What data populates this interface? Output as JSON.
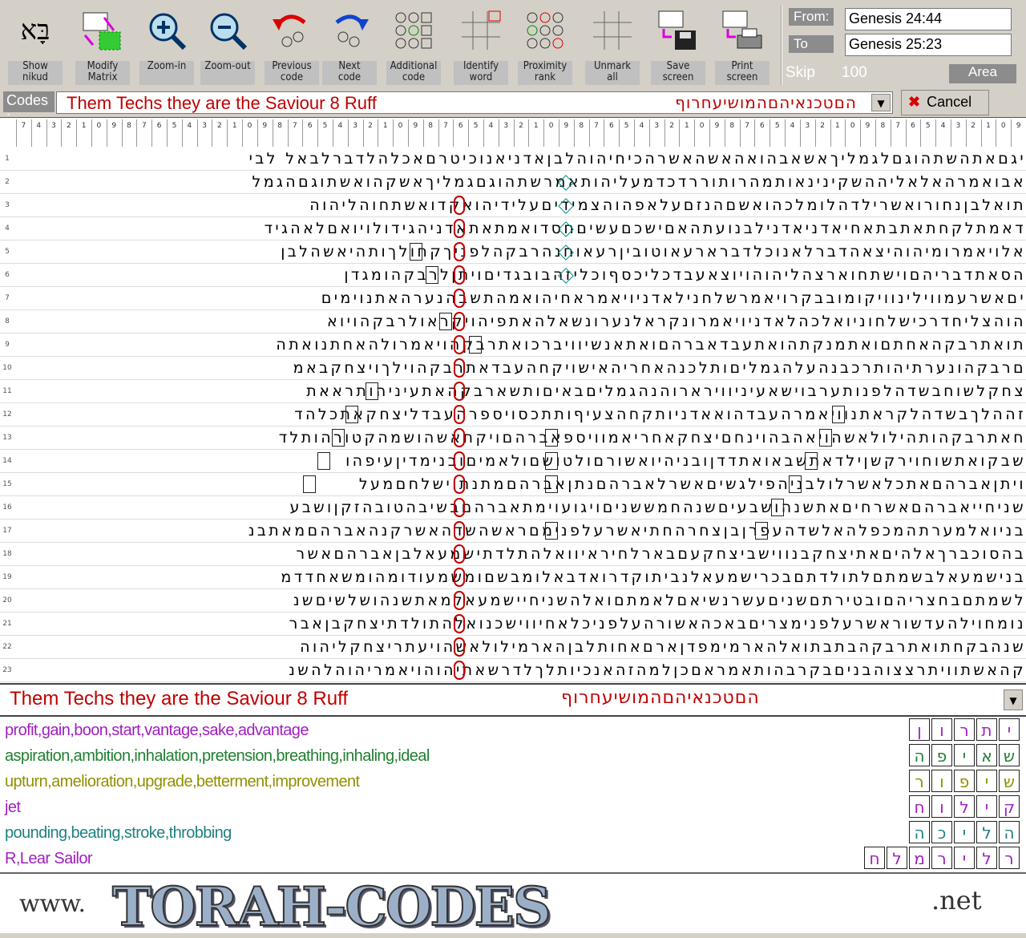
{
  "toolbar": {
    "buttons": [
      {
        "icon": "hebrew-nikud-icon",
        "label": "Show\nnikud"
      },
      {
        "icon": "matrix-edit-icon",
        "label": "Modify\nMatrix"
      },
      {
        "icon": "zoom-in-icon",
        "label": "Zoom-in"
      },
      {
        "icon": "zoom-out-icon",
        "label": "Zoom-out"
      },
      {
        "icon": "previous-code-icon",
        "label": "Previous\ncode"
      },
      {
        "icon": "next-code-icon",
        "label": "Next\ncode"
      },
      {
        "icon": "additional-code-icon",
        "label": "Additional\ncode"
      },
      {
        "icon": "identify-word-icon",
        "label": "Identify\nword"
      },
      {
        "icon": "proximity-rank-icon",
        "label": "Proximity\nrank"
      },
      {
        "icon": "unmark-all-icon",
        "label": "Unmark\nall"
      },
      {
        "icon": "save-screen-icon",
        "label": "Save\nscreen"
      },
      {
        "icon": "print-screen-icon",
        "label": "Print\nscreen"
      }
    ],
    "nikud_glyph": "בָּא",
    "from_label": "From:",
    "from_value": "Genesis 24:44",
    "to_label": "To",
    "to_value": "Genesis 25:23",
    "skip_label": "Skip",
    "skip_value": "100",
    "area_label": "Area"
  },
  "codes": {
    "label": "Codes :",
    "english": "Them Techs they are the Saviour 8 Ruff",
    "hebrew": "הםטכנאיהםהמושיעחרוף",
    "cancel_label": "Cancel"
  },
  "ruler": [
    "7",
    "4",
    "3",
    "2",
    "1",
    "0",
    "9",
    "8",
    "7",
    "6",
    "5",
    "4",
    "3",
    "2",
    "1",
    "0",
    "9",
    "8",
    "7",
    "6",
    "5",
    "4",
    "3",
    "2",
    "1",
    "0",
    "9",
    "8",
    "7",
    "6",
    "5",
    "4",
    "3",
    "2",
    "1",
    "0",
    "9",
    "8",
    "7",
    "6",
    "5",
    "4",
    "3",
    "2",
    "1",
    "0",
    "9",
    "8",
    "7",
    "6",
    "5",
    "4",
    "3",
    "2",
    "1",
    "0",
    "9",
    "8",
    "7",
    "6",
    "5",
    "4",
    "3",
    "2",
    "1",
    "0",
    "9"
  ],
  "grid": {
    "row_numbers": [
      "1",
      "2",
      "3",
      "4",
      "5",
      "6",
      "7",
      "8",
      "9",
      "10",
      "11",
      "12",
      "13",
      "14",
      "15",
      "16",
      "17",
      "18",
      "19",
      "20",
      "21",
      "22",
      "23"
    ],
    "rows": [
      "יגםאתהשתהוגםלגמליךאשאבהואהאשהאשרהכיחיהוהלבןאדניאנוכיטרםאכלהלדברלבאל לבי",
      "אבואמרהאלאליההשקינינאותמהרותוררדכדמעליהותאמרשתהוגםגמליךאשקהואשתוגםהגמל",
      "תואלבןנחורואשרילדהלומלכהואשםהנזםעלאפהוהצמידיםעלידיהואקדואשתחוהליהוה",
      "דאמתלקחתאתבתאחיאדניאדנילבנועתהאםישכםעשיםחסדואמתאתאדניהגידולויואםלאהגיד",
      "אלויאמרומיהוהיצאהדברלאנוכלדברארעאוטוביןרעאוחנהרבקהלפניךקחולךותהיאשהלבן",
      "הסאתדבריהםוישתחוארצהליהוהויוצאעבדכליכסףוכליזהבובגדיםויתןלרבקהומגדן",
      "יםאשרעמווילינוויקומובבקרויאמרשלחנילאדניויאמראחיהואמהתשבהנערהאתנוימים",
      "הוהצליחדרכישלחוניואלכהלאדניויאמרונקראלנערונשאלהאתפיהויקראולרבקהויוא",
      "תואתרבקהאחתםואתמנקתהואתעבדאברהםואתאנשיוויברכואתרבקהויאמרולהאחתנואתה",
      "םרבקהונערתיהותרכבנהעלהגמליםותלכנהאחריהאישויקחהעבדאתרבקהוילךויצחקבאמ",
      "צחקלשוחבשדהלפנותערבוישאעיניווירארוהנהגמליםבאיםותשארבקהאתעיניהותראאת",
      "זההלךבשדהלקראתנוויאמרהעבדהואאדניותקחהצעיףותתכסויספרהעבדליצחקאתכלהד",
      "חאתרבקהותהילולאשהויאהבהוינחםיצחקאחריאמוויספאברהםויקחאשהושמהקטורהותלד",
      "שבקואתשוחוירקשןילדאתשבאואתדדןובניהיואשורםולטושםולאמיםובנימדיןעיפהו",
      "ויתןאברהםאתכלאשרלולבניהפילגשיםאשרלאברהםנתןאברהםמתנתוישלחםמעל",
      "שניחייאברהםאשרחיםאתשנהושבעיםשנהחמששניםויגועוימתאברהםבשיבהטובהזקןושבע",
      "בניואלמערתהמכפלהאלשדהעפרןבןצחרהחתיאשרעלפנימםראשהשדהאשרקנהאברהםמאתבנ",
      "בהסוכברךאלהיםאתיצחקבנווישביצחקעםבארלחיראיוואלהתלדתישמעאלבןאברהםאשר",
      "בנישמעאלבשמתםלתולדתםבכרישמעאלנביתוקדרואדבאלומבשםומשמעודומהומשאחדדמ",
      "לשמתםבחצריהםובטירתםשניםעשרנשיאםלאמתםואלהשניחיישמעאלמאתשנהושלשיםשנ",
      "נומחוילהעדשוראשרעלפנימצריםבאכהאשורהעלפניכלאחיווישכנואלהתולדתיצחקבןאבר",
      "שנהבקחתואתרבקהבתבתואלהארמימפדןארםאחותלבןהארמילולאשהויעתריצחקליהוה",
      "קהאשתוויתרצצוהבניםבקרבהותאמראםכןלמהזהאנכיותלךלדרשאתיהוהויאמריהוהלהשנ"
    ]
  },
  "result": {
    "english": "Them Techs they are the Saviour 8 Ruff",
    "hebrew": "הםטכנאיהםהמושיעחרוף"
  },
  "definitions": [
    {
      "text": "profit,gain,boon,start,vantage,sake,advantage",
      "color": "#a020c0",
      "letters": [
        "י",
        "ת",
        "ר",
        "ו",
        "ן"
      ]
    },
    {
      "text": "aspiration,ambition,inhalation,pretension,breathing,inhaling,ideal",
      "color": "#208030",
      "letters": [
        "ש",
        "א",
        "י",
        "פ",
        "ה"
      ]
    },
    {
      "text": "upturn,amelioration,upgrade,betterment,improvement",
      "color": "#909000",
      "letters": [
        "ש",
        "י",
        "פ",
        "ו",
        "ר"
      ]
    },
    {
      "text": "jet",
      "color": "#a020c0",
      "letters": [
        "ק",
        "י",
        "ל",
        "ו",
        "ח"
      ]
    },
    {
      "text": "pounding,beating,stroke,throbbing",
      "color": "#208080",
      "letters": [
        "ה",
        "ל",
        "י",
        "כ",
        "ה"
      ]
    },
    {
      "text": "R,Lear Sailor",
      "color": "#a020c0",
      "letters": [
        "ר",
        "ל",
        "י",
        "ר",
        "מ",
        "ל",
        "ח"
      ]
    }
  ],
  "banner": {
    "www": "www.",
    "logo": "TORAH-CODES",
    "net": ".net"
  },
  "colors": {
    "code_red": "#c00000",
    "bg_gray": "#d4d0c8"
  }
}
